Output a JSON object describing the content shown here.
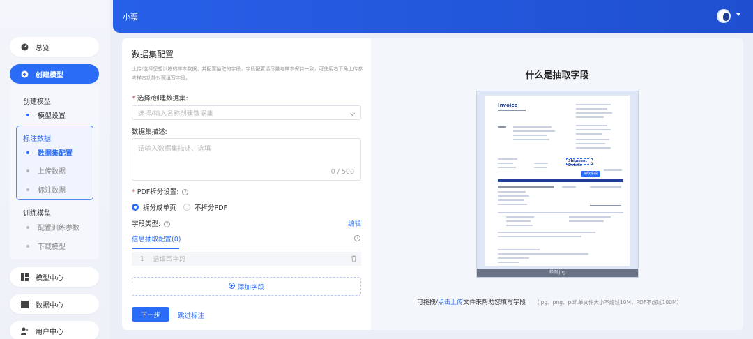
{
  "app": {
    "title": "小票"
  },
  "sidebar": {
    "overview": "总览",
    "create_model": "创建模型",
    "group_create": "创建模型",
    "model_settings": "模型设置",
    "group_label": "标注数据",
    "dataset_config": "数据集配置",
    "upload_data": "上传数据",
    "label_data": "标注数据",
    "group_train": "训练模型",
    "train_params": "配置训练参数",
    "download_model": "下载模型",
    "model_center": "模型中心",
    "data_center": "数据中心",
    "user_center": "用户中心"
  },
  "form": {
    "title": "数据集配置",
    "description": "上传/选择您想训练的样本数据，并配置抽取的字段，字段配置请尽量与样本保持一致，可使用右下角上传参考样本功能对照填写字段。",
    "dataset_label": "选择/创建数据集:",
    "dataset_placeholder": "选择/输入名称创建数据集",
    "desc_label": "数据集描述:",
    "desc_placeholder": "请输入数据集描述、选填",
    "desc_counter": "0 / 500",
    "pdf_label": "PDF拆分设置:",
    "pdf_option_split": "拆分成单页",
    "pdf_option_nosplit": "不拆分PDF",
    "field_type_label": "字段类型:",
    "edit_link": "编辑",
    "tab_extract": "信息抽取配置(0)",
    "row_index": "1",
    "row_placeholder": "请填写字段",
    "add_field": "添加字段",
    "next_button": "下一步",
    "skip_link": "跳过标注"
  },
  "preview": {
    "title": "什么是抽取字段",
    "doc_heading": "Invoice",
    "doc_box_label": "Shipment Details",
    "doc_tooltip": "抽取字段",
    "doc_filename": "样例.jpg",
    "footer_prefix": "可拖拽/",
    "footer_link": "点击上传",
    "footer_suffix": "文件来帮助您填写字段",
    "footer_note": "（jpg、png、pdf,单文件大小不超过10M，PDF不超过100M）"
  },
  "colors": {
    "primary": "#2a6cf5",
    "topbar": "#2760e8",
    "required": "#e84a4a"
  }
}
